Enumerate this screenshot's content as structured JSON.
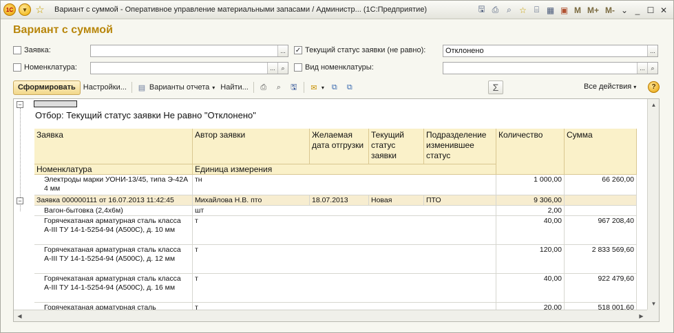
{
  "titlebar": {
    "title": "Вариант с суммой - Оперативное управление материальными запасами / Администр... (1С:Предприятие)",
    "m_buttons": [
      "M",
      "M+",
      "M-"
    ]
  },
  "form": {
    "title": "Вариант с суммой",
    "filters": {
      "zayavka": {
        "label": "Заявка:",
        "checked": false,
        "value": ""
      },
      "nomenklatura": {
        "label": "Номенклатура:",
        "checked": false,
        "value": ""
      },
      "status": {
        "label": "Текущий статус заявки (не равно):",
        "checked": true,
        "value": "Отклонено"
      },
      "vid": {
        "label": "Вид номенклатуры:",
        "checked": false,
        "value": ""
      }
    }
  },
  "toolbar": {
    "generate": "Сформировать",
    "settings": "Настройки...",
    "variants": "Варианты отчета",
    "find": "Найти...",
    "all_actions": "Все действия",
    "sigma": "Σ",
    "help": "?"
  },
  "report": {
    "filter_text": "Отбор:    Текущий статус заявки Не равно \"Отклонено\"",
    "headers": {
      "zayavka": "Заявка",
      "avtor": "Автор заявки",
      "data": "Желаемая дата отгрузки",
      "status": "Текущий статус заявки",
      "podr": "Подразделение изменившее статус",
      "kol": "Количество",
      "summa": "Сумма",
      "nomen": "Номенклатура",
      "ed": "Единица измерения"
    },
    "rows": [
      {
        "name": "Электроды марки УОНИ-13/45, типа Э-42А 4 мм",
        "unit": "тн",
        "qty": "1 000,00",
        "sum": "66 260,00"
      },
      {
        "name": "Заявка 000000111 от 16.07.2013 11:42:45",
        "author": "Михайлова Н.В. пто",
        "date": "18.07.2013",
        "status": "Новая",
        "dept": "ПТО",
        "qty": "9 306,00",
        "sum": ""
      },
      {
        "name": "Вагон-бытовка (2,4х6м)",
        "unit": "шт",
        "qty": "2,00",
        "sum": ""
      },
      {
        "name": "Горячекатаная арматурная сталь класса А-III ТУ 14-1-5254-94 (А500С), д. 10 мм",
        "unit": "т",
        "qty": "40,00",
        "sum": "967 208,40"
      },
      {
        "name": "Горячекатаная арматурная сталь класса А-III ТУ 14-1-5254-94 (А500С), д. 12 мм",
        "unit": "т",
        "qty": "120,00",
        "sum": "2 833 569,60"
      },
      {
        "name": "Горячекатаная арматурная сталь класса А-III ТУ 14-1-5254-94 (А500С), д. 16 мм",
        "unit": "т",
        "qty": "40,00",
        "sum": "922 479,60"
      },
      {
        "name": "Горячекатаная арматурная сталь",
        "unit": "т",
        "qty": "20,00",
        "sum": "518 001,60"
      }
    ]
  },
  "colors": {
    "accent": "#b8860b",
    "header_bg": "#faf1c9"
  }
}
